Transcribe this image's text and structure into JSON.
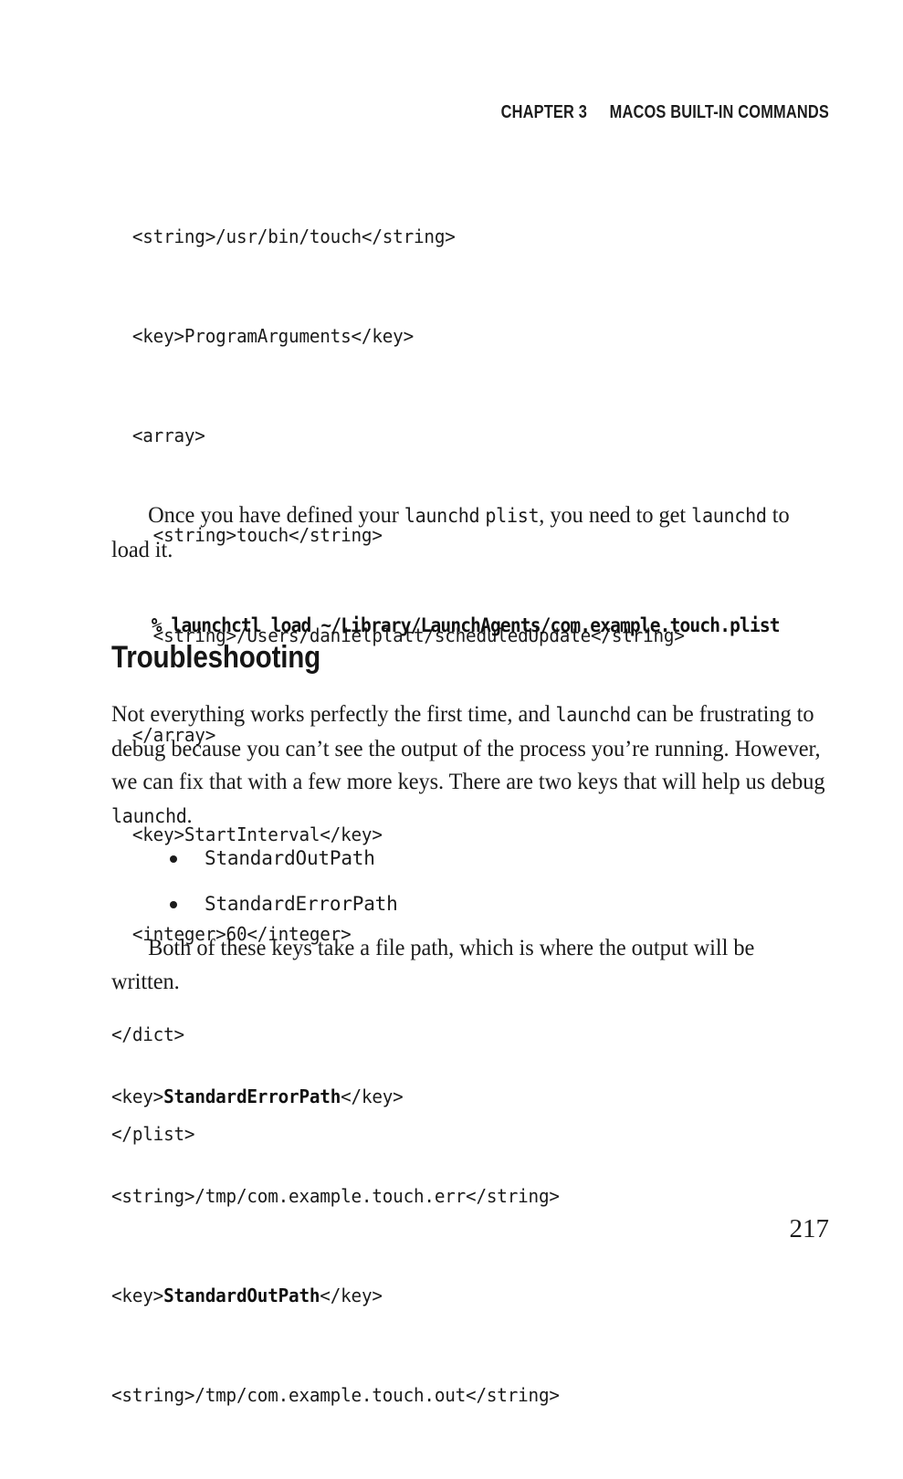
{
  "page": {
    "background": "#ffffff",
    "text_color": "#1b1b1b",
    "folio": "217"
  },
  "running_head": {
    "chapter": "CHAPTER 3",
    "title": "MACOS BUILT-IN COMMANDS"
  },
  "code_block_plist": {
    "lines": [
      "  <string>/usr/bin/touch</string>",
      "  <key>ProgramArguments</key>",
      "  <array>",
      "    <string>touch</string>",
      "    <string>/Users/danielplatt/scheduledUpdate</string>",
      "  </array>",
      "  <key>StartInterval</key>",
      "  <integer>60</integer>",
      "</dict>",
      "</plist>"
    ]
  },
  "paragraph_load": {
    "part1": "Once you have defined your ",
    "code1": "launchd",
    "part2": " ",
    "code2": "plist",
    "part3": ", you need to get ",
    "code3": "launchd",
    "part4": " to load it."
  },
  "command_line": {
    "text": "% launchctl load ~/Library/LaunchAgents/com.example.touch.plist"
  },
  "section_heading": {
    "text": "Troubleshooting"
  },
  "paragraph_debug": {
    "part1": "Not everything works perfectly the first time, and ",
    "code1": "launchd",
    "part2": " can be frustrating to debug because you can’t see the output of the process you’re running. However, we can fix that with a few more keys. There are two keys that will help us debug ",
    "code2": "launchd",
    "part3": "."
  },
  "key_list": {
    "items": [
      "StandardOutPath",
      "StandardErrorPath"
    ]
  },
  "paragraph_filepath": {
    "part1": "Both of these keys take a file path, which is where the output will be written."
  },
  "code_block_paths": {
    "lines": [
      {
        "pre": "<key>",
        "bold": "StandardErrorPath",
        "post": "</key>"
      },
      {
        "pre": "<string>/tmp/com.example.touch.err</string>",
        "bold": "",
        "post": ""
      },
      {
        "pre": "<key>",
        "bold": "StandardOutPath",
        "post": "</key>"
      },
      {
        "pre": "<string>/tmp/com.example.touch.out</string>",
        "bold": "",
        "post": ""
      }
    ]
  }
}
